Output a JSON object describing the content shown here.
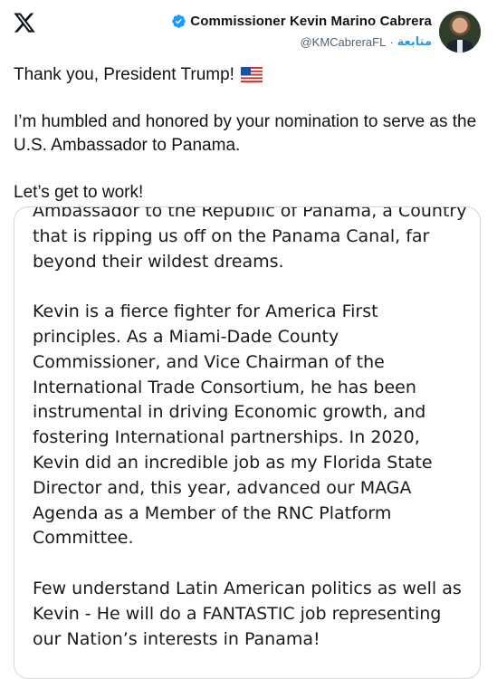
{
  "author": {
    "name": "Commissioner Kevin Marino Cabrera",
    "follow_label": "متابعة",
    "separator": "·",
    "handle": "@KMCabreraFL"
  },
  "tweet": {
    "line1": "Thank you, President Trump!",
    "line2": "I’m humbled and honored by your nomination to serve as the U.S. Ambassador to Panama.",
    "line3": "Let’s get to work!"
  },
  "card": {
    "para1": "Ambassador to the Republic of Panama, a Country that is ripping us off on the Panama Canal, far beyond their wildest dreams.",
    "para2": "Kevin is a fierce fighter for America First principles. As a Miami-Dade County Commissioner, and Vice Chairman of the International Trade Consortium, he has been instrumental in driving Economic growth, and fostering International partnerships. In 2020, Kevin did an incredible job as my Florida State Director and, this year, advanced our MAGA Agenda as a Member of the RNC Platform Committee.",
    "para3": "Few understand Latin American politics as well as Kevin - He will do a FANTASTIC job representing our Nation’s interests in Panama!"
  },
  "colors": {
    "accent": "#1d9bf0",
    "text": "#0f1419",
    "muted": "#536471",
    "border": "#cfd9de"
  }
}
